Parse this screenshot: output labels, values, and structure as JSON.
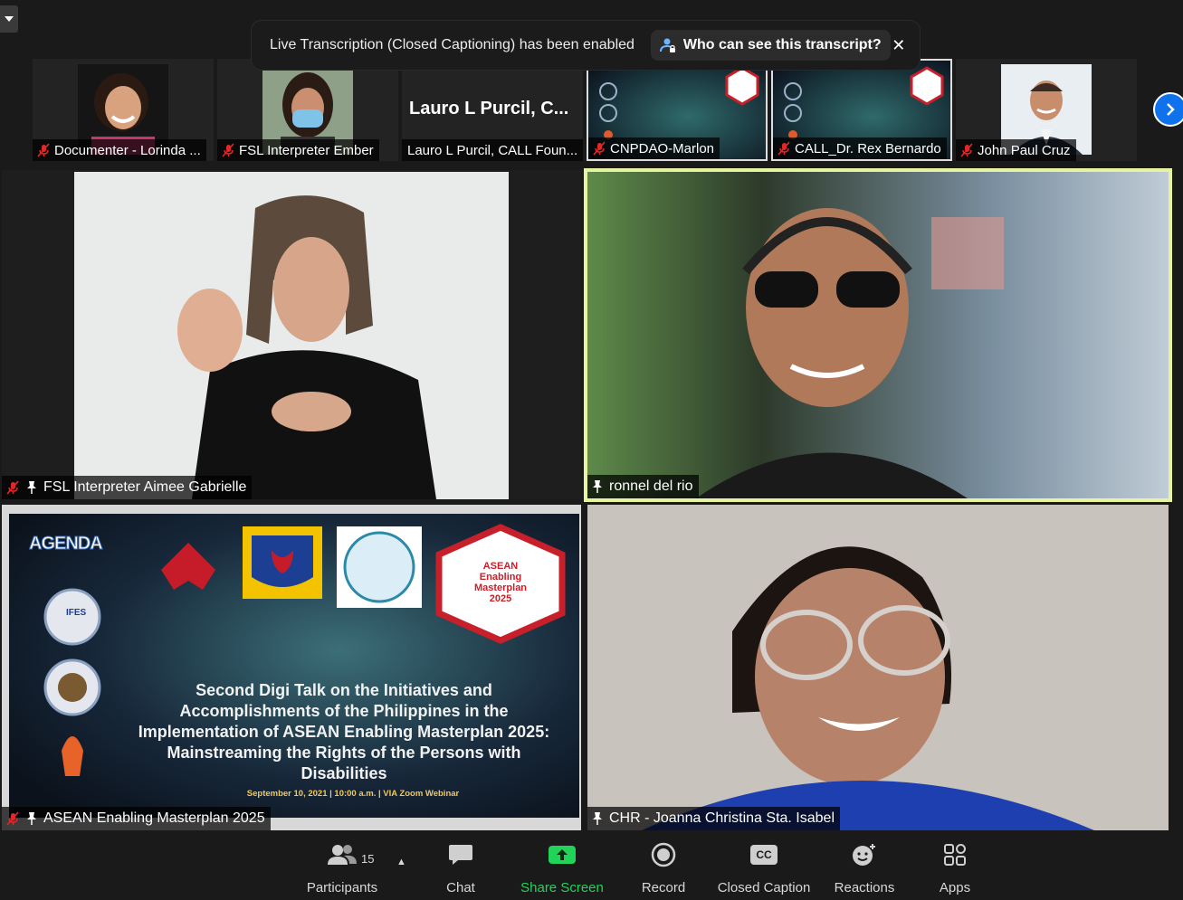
{
  "banner": {
    "message": "Live Transcription (Closed Captioning) has been enabled",
    "who_label": "Who can see this transcript?",
    "close_symbol": "✕"
  },
  "filmstrip": [
    {
      "name": "Documenter - Lorinda ...",
      "muted": true
    },
    {
      "name": "FSL Interpreter Ember",
      "muted": true
    },
    {
      "name": "Lauro L Purcil, CALL Foun...",
      "muted": false,
      "display_name": "Lauro L Purcil, C..."
    },
    {
      "name": "CNPDAO-Marlon",
      "muted": true
    },
    {
      "name": "CALL_Dr. Rex Bernardo",
      "muted": true
    },
    {
      "name": "John Paul Cruz",
      "muted": true
    }
  ],
  "tiles": {
    "aimee": {
      "name": "FSL Interpreter Aimee Gabrielle"
    },
    "ronnel": {
      "name": "ronnel del rio"
    },
    "asean": {
      "name": "ASEAN Enabling Masterplan 2025"
    },
    "joanna": {
      "name": "CHR - Joanna Christina Sta. Isabel"
    }
  },
  "slide": {
    "title": "Second Digi Talk on the Initiatives and Accomplishments of the Philippines in the Implementation of ASEAN Enabling Masterplan 2025: Mainstreaming the Rights of the Persons with Disabilities",
    "date_line": "September 10, 2021 | 10:00 a.m. | VIA Zoom Webinar",
    "agenda_logo": "AGENDA",
    "ifes_logo": "IFES",
    "masterplan_logo": "ASEAN Enabling Masterplan 2025"
  },
  "toolbar": {
    "participants": "Participants",
    "participants_count": "15",
    "chat": "Chat",
    "share_screen": "Share Screen",
    "record": "Record",
    "closed_caption": "Closed Caption",
    "cc_badge": "CC",
    "reactions": "Reactions",
    "apps": "Apps"
  },
  "colors": {
    "accent": "#0e72ed",
    "share_green": "#22d35a",
    "active_speaker": "#e7f3a0",
    "muted_red": "#e02828"
  }
}
